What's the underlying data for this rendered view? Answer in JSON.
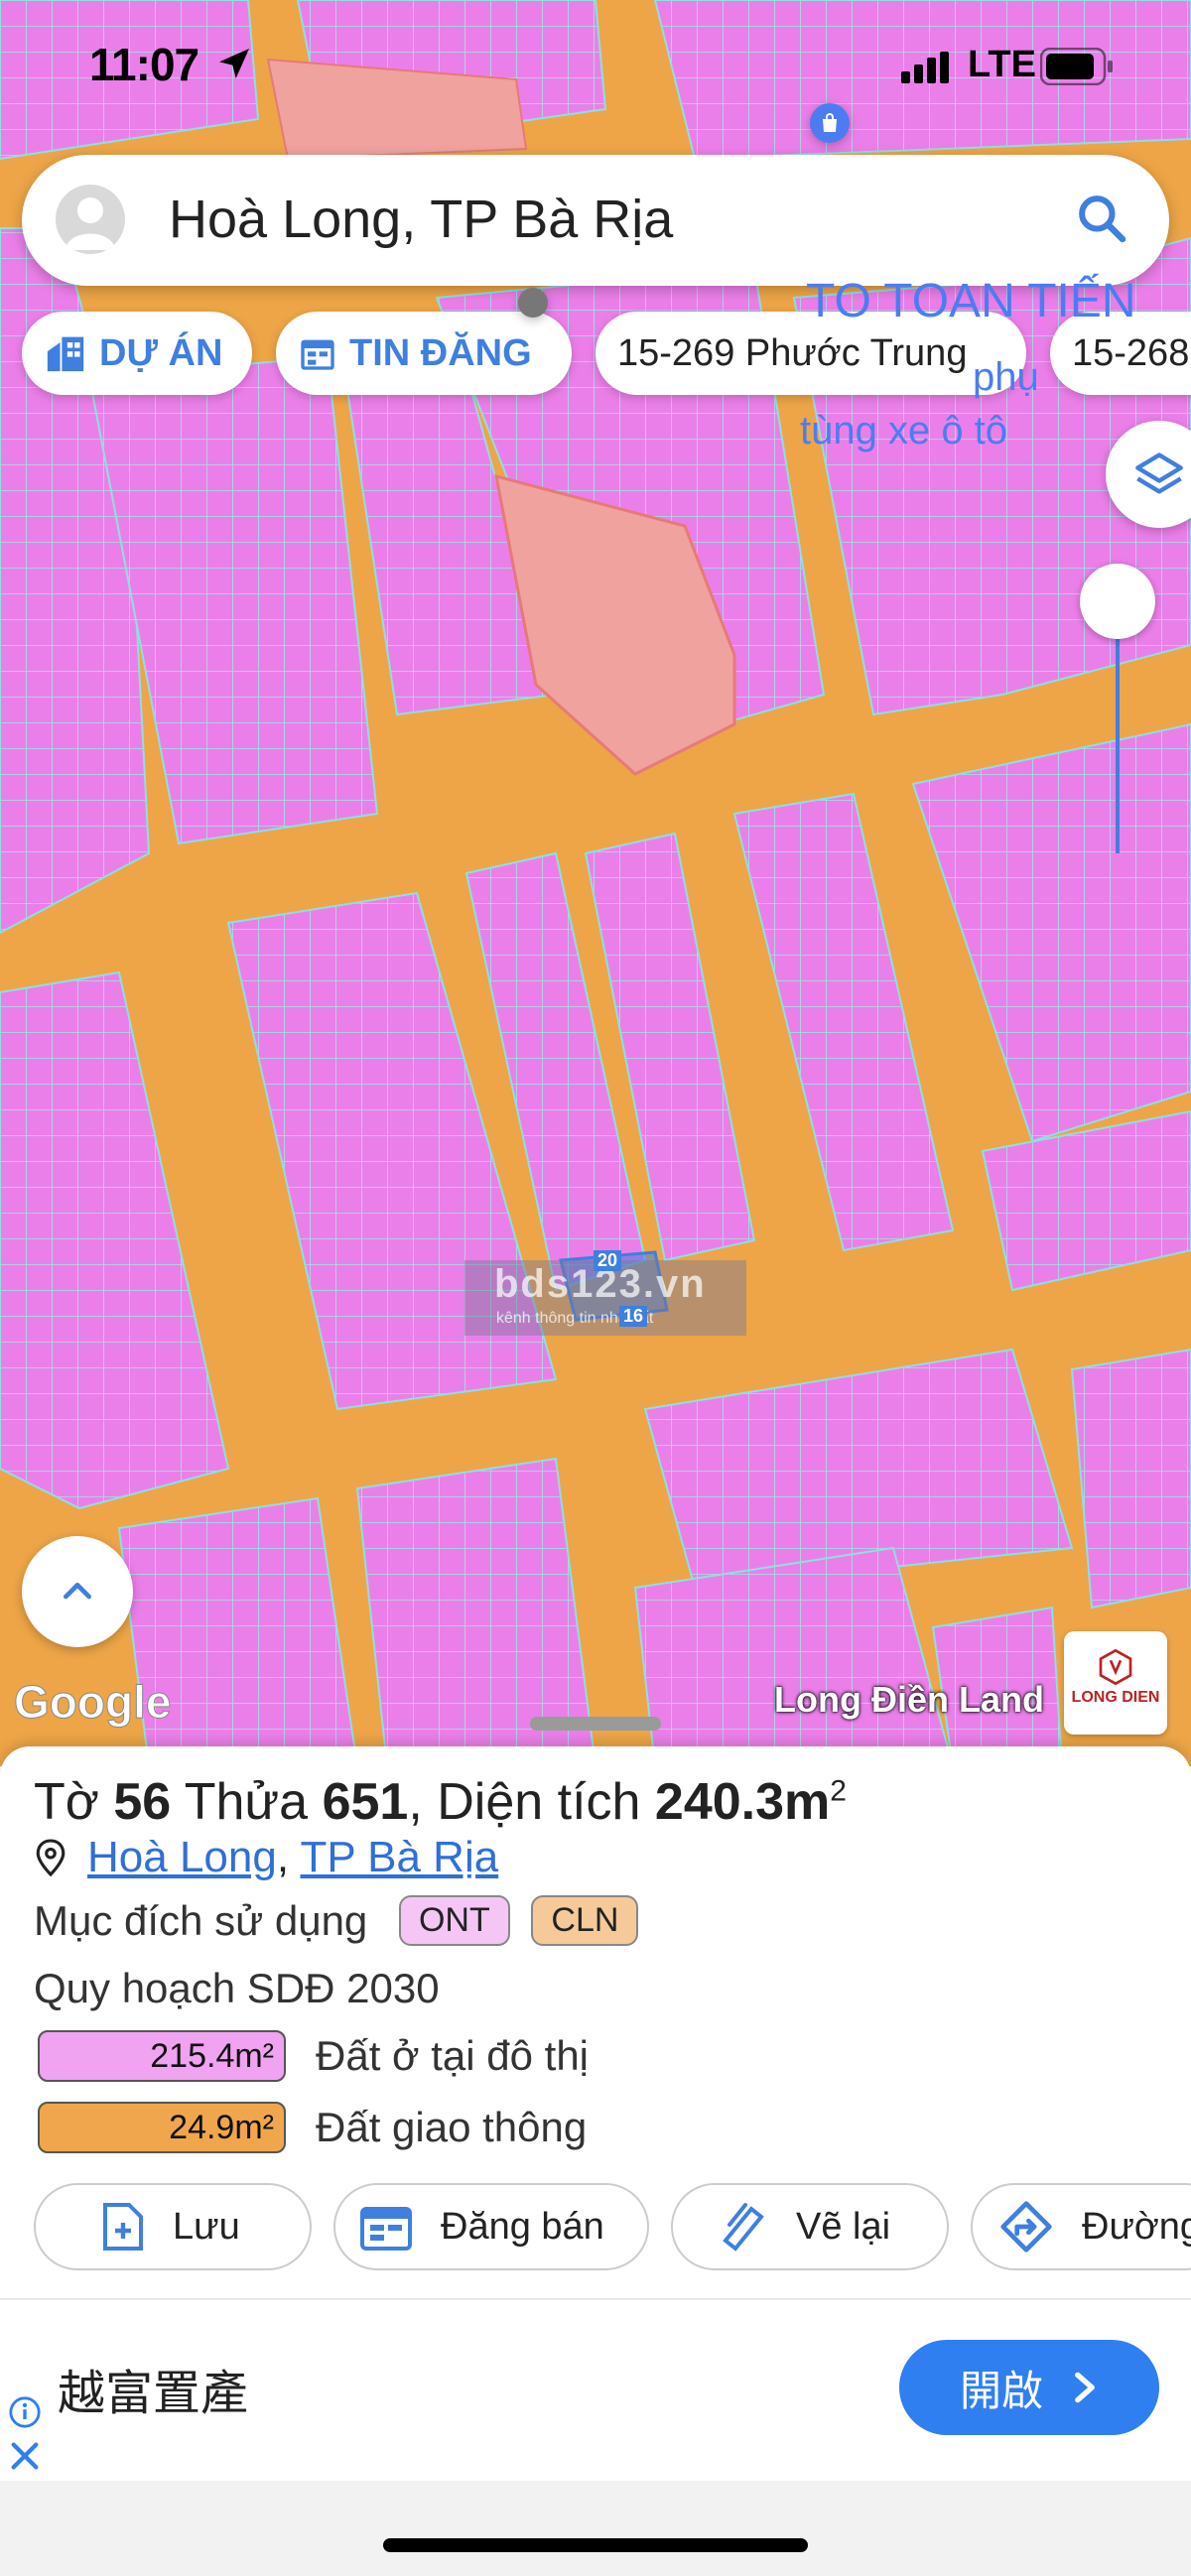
{
  "status_bar": {
    "time": "11:07",
    "network": "LTE"
  },
  "search": {
    "text": "Hoà Long, TP Bà Rịa"
  },
  "chips": [
    {
      "label": "DỰ ÁN"
    },
    {
      "label": "TIN ĐĂNG"
    },
    {
      "label": "15-269 Phước Trung"
    },
    {
      "label": "15-268"
    }
  ],
  "map_labels": {
    "poi_line1": "TO TOAN TIẾN",
    "poi_line2": "tùng xe ô tô",
    "poi_fragment": "phụ"
  },
  "watermark": {
    "main": "bds123.vn",
    "sub": "kênh thông tin nhà đất"
  },
  "plot_numbers": {
    "top": "20",
    "bottom": "16"
  },
  "attribution": {
    "google": "Google",
    "credit": "Long Điền Land",
    "logo": "LONG DIEN"
  },
  "parcel": {
    "sheet_label": "Tờ",
    "sheet": "56",
    "plot_label": "Thửa",
    "plot": "651",
    "area_label": "Diện tích",
    "area": "240.3m",
    "area_sup": "2",
    "ward": "Hoà Long",
    "city": "TP Bà Rịa",
    "purpose_label": "Mục đích sử dụng",
    "purpose_tags": [
      "ONT",
      "CLN"
    ],
    "plan_label": "Quy hoạch SDĐ 2030",
    "zones": [
      {
        "area": "215.4m²",
        "label": "Đất ở tại đô thị",
        "color": "#f0a3f0"
      },
      {
        "area": "24.9m²",
        "label": "Đất giao thông",
        "color": "#f0a64c"
      }
    ]
  },
  "actions": [
    {
      "label": "Lưu",
      "icon": "file-plus-icon"
    },
    {
      "label": "Đăng bán",
      "icon": "calendar-icon"
    },
    {
      "label": "Vẽ lại",
      "icon": "draw-pen-icon"
    },
    {
      "label": "Đường",
      "icon": "directions-icon"
    }
  ],
  "ad": {
    "text": "越富置產",
    "button": "開啟"
  },
  "colors": {
    "residential": "#eb7fe9",
    "road": "#eda547",
    "accent": "#3f7fe0",
    "salmon": "#f0a29e"
  }
}
